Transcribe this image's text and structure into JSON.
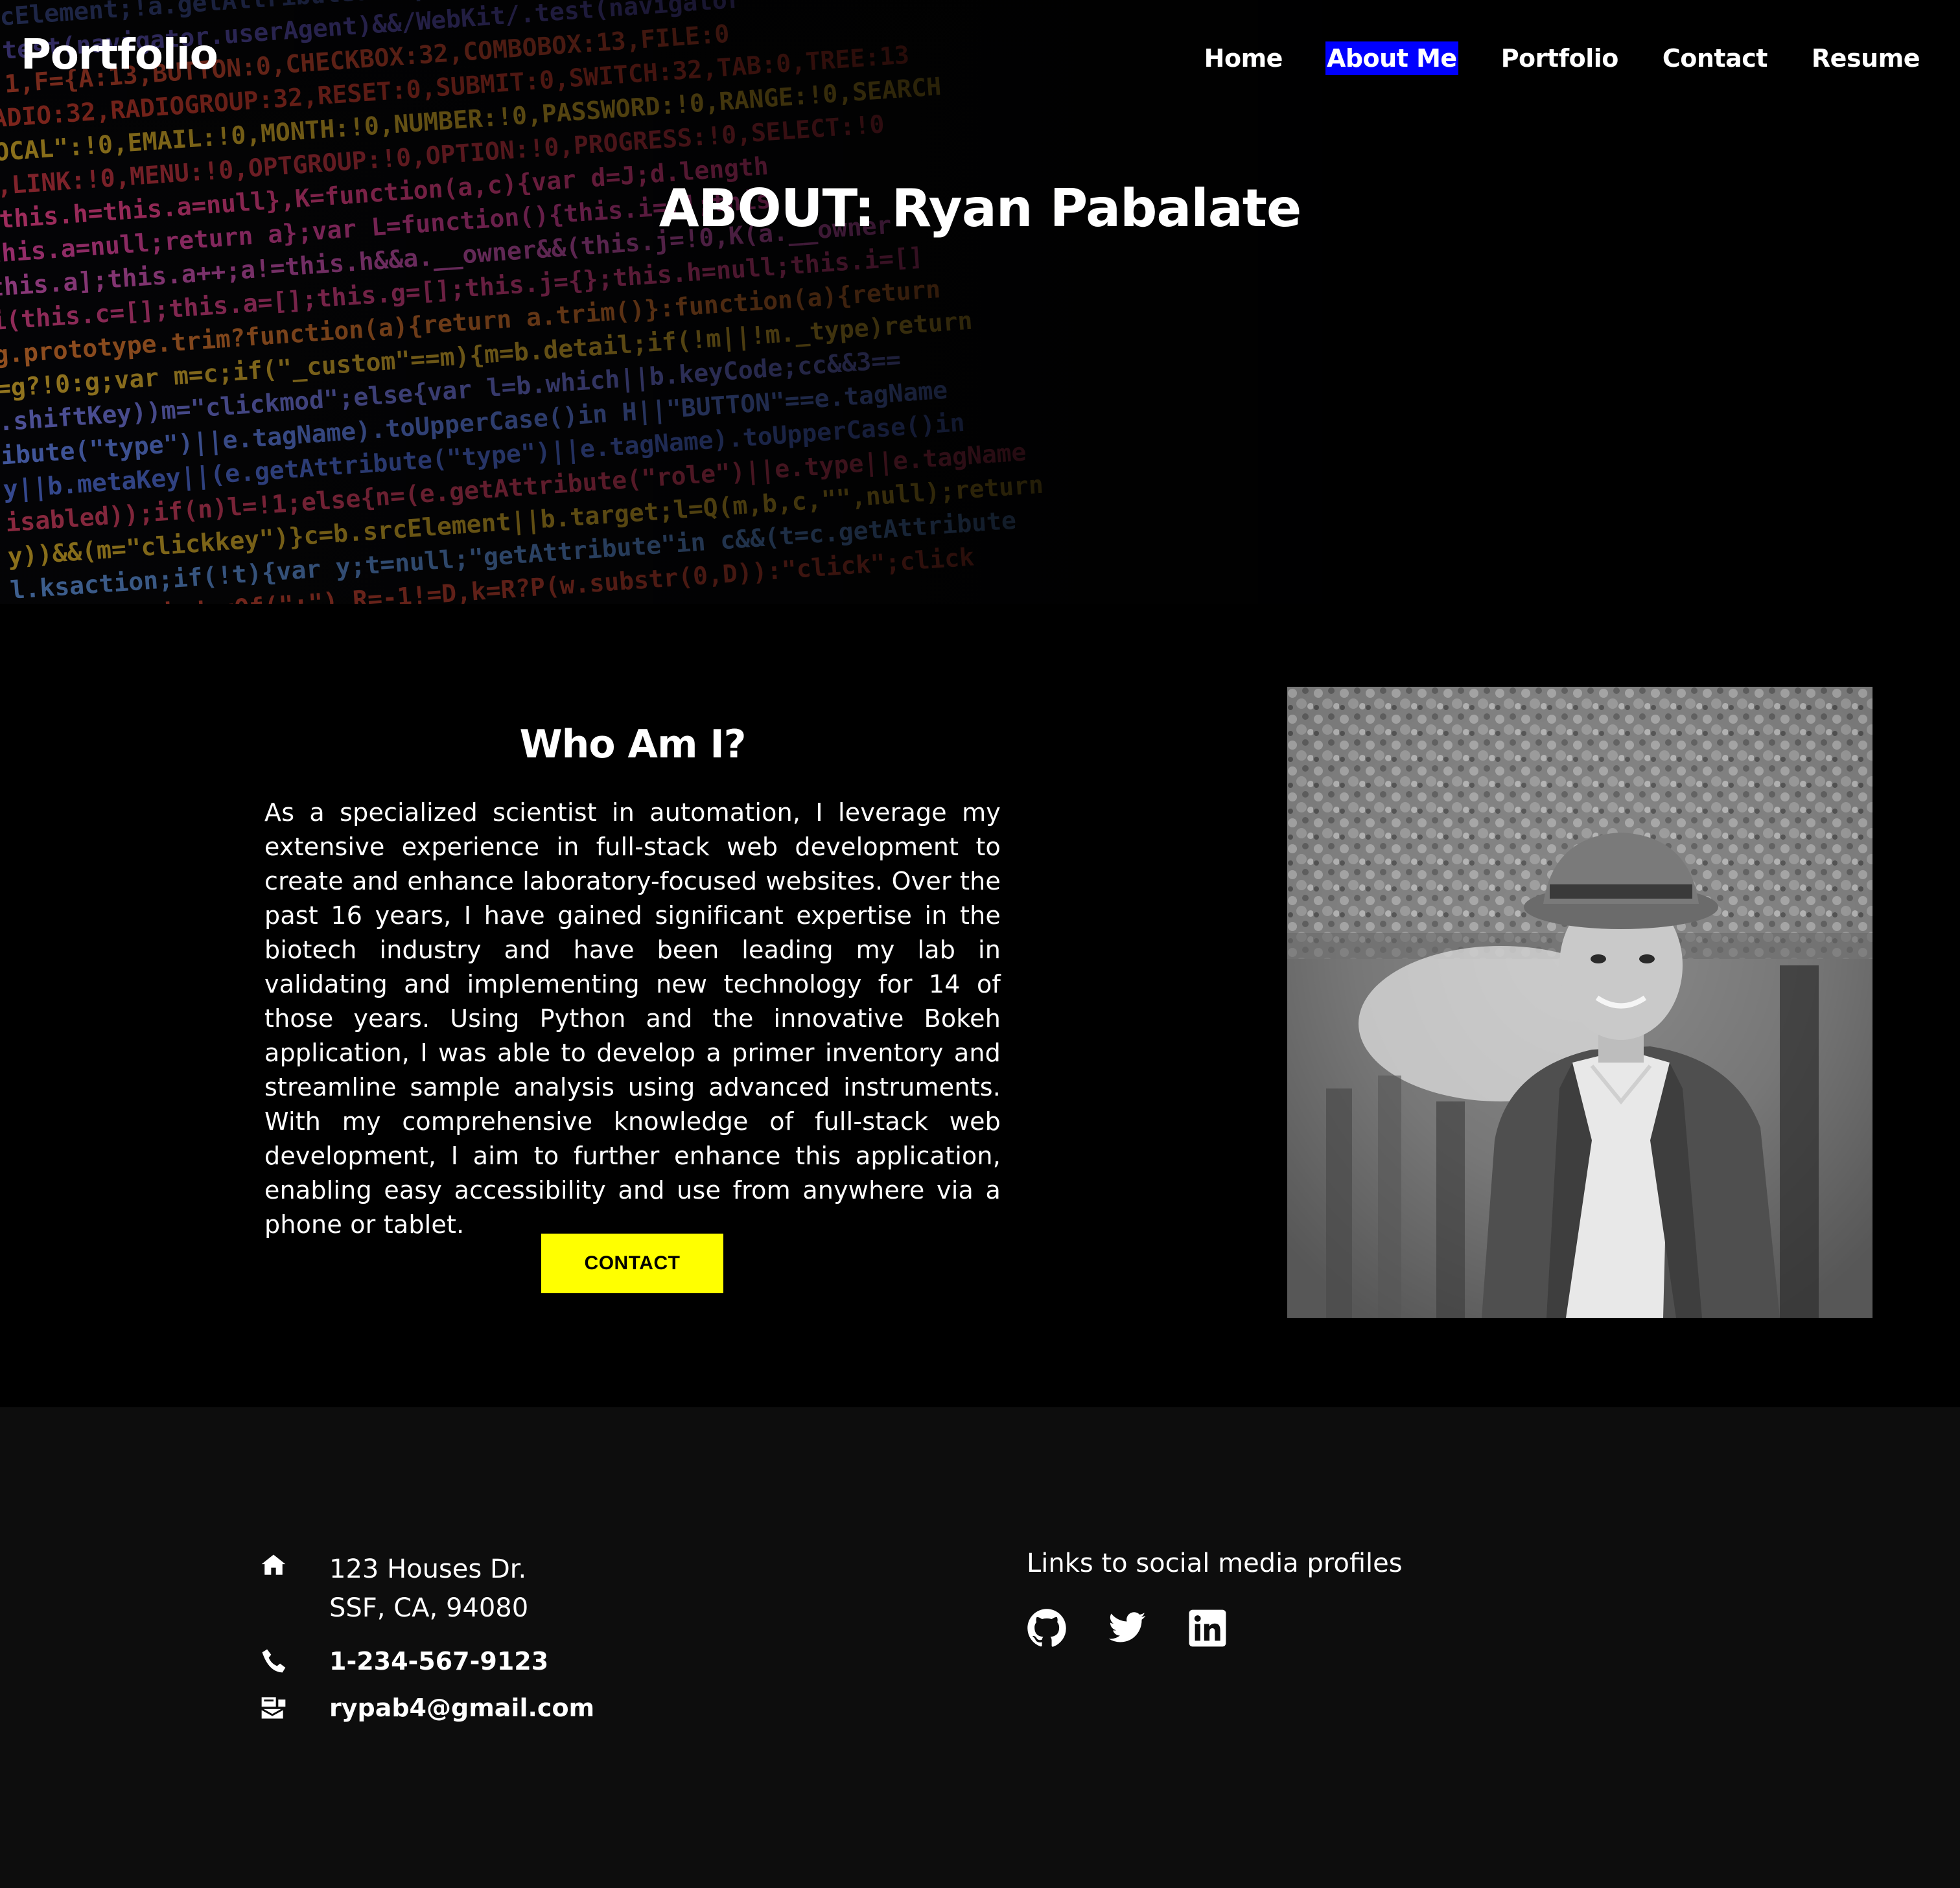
{
  "brand": "Portfolio",
  "nav": [
    {
      "label": "Home",
      "active": false
    },
    {
      "label": "About Me",
      "active": true
    },
    {
      "label": "Portfolio",
      "active": false
    },
    {
      "label": "Contact",
      "active": false
    },
    {
      "label": "Resume",
      "active": false
    }
  ],
  "hero": {
    "title": "ABOUT: Ryan Pabalate"
  },
  "about": {
    "heading": "Who Am I?",
    "bio": "As a specialized scientist in automation, I leverage my extensive experience in full-stack web development to create and enhance laboratory-focused websites. Over the past 16 years, I have gained significant expertise in the biotech industry and have been leading my lab in validating and implementing new technology for 14 of those years. Using Python and the innovative Bokeh application, I was able to develop a primer inventory and streamline sample analysis using advanced instruments. With my comprehensive knowledge of full-stack web development, I aim to further enhance this application, enabling easy accessibility and use from anywhere via a phone or tablet.",
    "contact_button": "CONTACT"
  },
  "footer": {
    "address_line1": "123 Houses Dr.",
    "address_line2": "SSF, CA, 94080",
    "phone": "1-234-567-9123",
    "email": "rypab4@gmail.com",
    "social_heading": "Links to social media profiles",
    "social_icons": [
      "github-icon",
      "twitter-icon",
      "linkedin-icon"
    ]
  },
  "colors": {
    "active_nav_bg": "#0000ff",
    "button_bg": "#ffff00",
    "footer_bg": "#0d0d0d",
    "page_bg": "#000000"
  }
}
